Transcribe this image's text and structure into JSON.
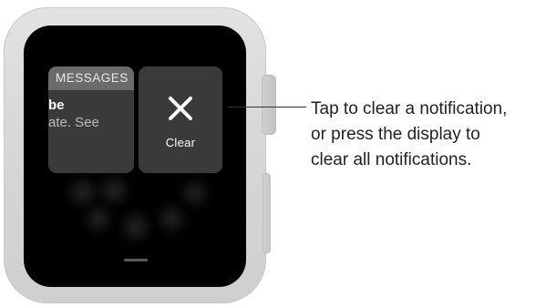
{
  "notification": {
    "app_name": "MESSAGES",
    "title_fragment": "be",
    "body_fragment": "ate. See"
  },
  "clear_action": {
    "icon": "close-icon",
    "label": "Clear"
  },
  "callout": {
    "line1": "Tap to clear a notification,",
    "line2": "or press the display to",
    "line3": "clear all notifications."
  },
  "colors": {
    "screen": "#000000",
    "card": "#3a3a3a",
    "header": "#6b6b6b",
    "case": "#d8d8d8"
  }
}
